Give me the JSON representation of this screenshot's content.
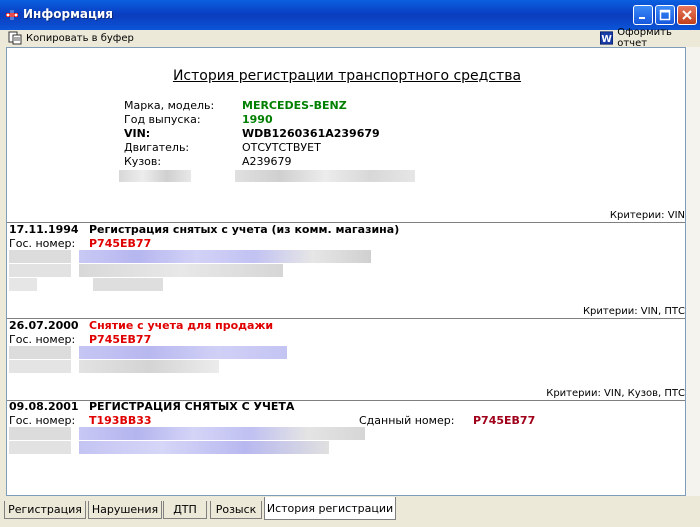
{
  "window": {
    "title": "Информация"
  },
  "toolbar": {
    "copy_label": "Копировать в буфер",
    "report_label": "Оформить отчет"
  },
  "report": {
    "title": "История регистрации транспортного средства",
    "vehicle": [
      {
        "label": "Марка, модель:",
        "value": "MERCEDES-BENZ"
      },
      {
        "label": "Год выпуска:",
        "value": "1990"
      },
      {
        "label": "VIN:",
        "value": "WDB1260361A239679"
      },
      {
        "label": "Двигатель:",
        "value": "ОТСУТСТВУЕТ"
      },
      {
        "label": "Кузов:",
        "value": "A239679"
      }
    ],
    "plate_label": "Гос. номер:",
    "entries": [
      {
        "criteria": "Критерии: VIN",
        "date": "17.11.1994",
        "title": "Регистрация снятых с учета (из комм. магазина)",
        "plate": "Р745ЕВ77"
      },
      {
        "criteria": "Критерии: VIN, ПТС",
        "date": "26.07.2000",
        "title": "Снятие с учета для продажи",
        "plate": "Р745ЕВ77"
      },
      {
        "criteria": "Критерии: VIN, Кузов, ПТС",
        "date": "09.08.2001",
        "title": "РЕГИСТРАЦИЯ СНЯТЫХ С УЧЕТА",
        "plate": "Т193ВВ33",
        "surrendered_label": "Сданный номер:",
        "surrendered_value": "Р745ЕВ77"
      }
    ]
  },
  "tabs": [
    {
      "label": "Регистрация"
    },
    {
      "label": "Нарушения"
    },
    {
      "label": "ДТП"
    },
    {
      "label": "Розыск"
    },
    {
      "label": "История регистрации",
      "active": true
    }
  ],
  "colors": {
    "green": "#008000",
    "red": "#e00000",
    "dark_red": "#a0001a",
    "titlebar": "#0a3fc4"
  }
}
